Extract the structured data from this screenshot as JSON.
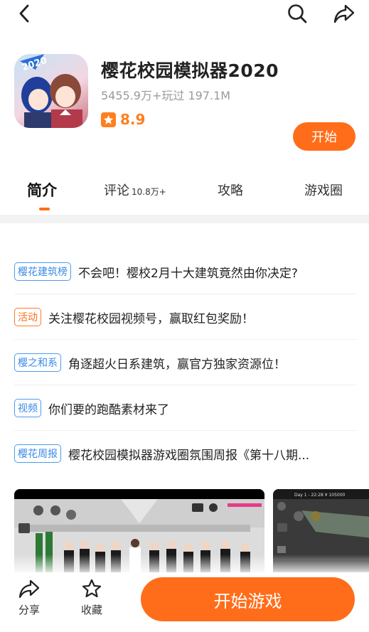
{
  "app": {
    "title": "樱花校园模拟器2020",
    "stats": "5455.9万+玩过  197.1M",
    "rating": "8.9",
    "start_label": "开始",
    "icon_badge": "2020"
  },
  "tabs": [
    {
      "label": "简介",
      "active": true
    },
    {
      "label": "评论",
      "count": "10.8万+"
    },
    {
      "label": "攻略"
    },
    {
      "label": "游戏圈"
    }
  ],
  "news": [
    {
      "tag": "樱花建筑榜",
      "tag_color": "blue",
      "text": "不会吧！樱校2月十大建筑竟然由你决定?"
    },
    {
      "tag": "活动",
      "tag_color": "orange",
      "text": "关注樱花校园视频号，赢取红包奖励！"
    },
    {
      "tag": "樱之和系",
      "tag_color": "blue",
      "text": "角逐超火日系建筑，赢官方独家资源位！"
    },
    {
      "tag": "视频",
      "tag_color": "blue",
      "text": "你们要的跑酷素材来了"
    },
    {
      "tag": "樱花周报",
      "tag_color": "blue",
      "text": "樱花校园模拟器游戏圈氛围周报《第十八期..."
    }
  ],
  "screenshots": {
    "shot2_hud": "Day 1 - 22:28  ¥ 105000"
  },
  "bottom": {
    "share_label": "分享",
    "favorite_label": "收藏",
    "play_label": "开始游戏"
  },
  "colors": {
    "accent": "#ff6d1a",
    "tag_blue": "#3a8ae6",
    "rating": "#ff7f1e"
  }
}
